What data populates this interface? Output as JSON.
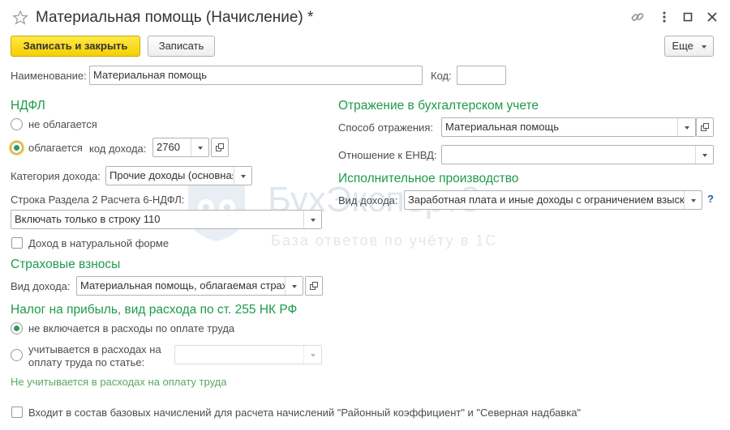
{
  "window": {
    "title": "Материальная помощь (Начисление) *",
    "star_icon": "star-outline-icon",
    "link_icon": "link-icon",
    "menu_icon": "more-vertical-icon",
    "maximize_icon": "maximize-icon",
    "close_icon": "close-icon"
  },
  "toolbar": {
    "save_close_label": "Записать и закрыть",
    "save_label": "Записать",
    "more_label": "Еще"
  },
  "name": {
    "label": "Наименование:",
    "value": "Материальная помощь"
  },
  "code": {
    "label": "Код:",
    "value": ""
  },
  "ndfl": {
    "heading": "НДФЛ",
    "not_taxed_label": "не облагается",
    "taxed_label": "облагается",
    "selected": "taxed",
    "income_code_label": "код дохода:",
    "income_code_value": "2760",
    "category_label": "Категория дохода:",
    "category_value": "Прочие доходы (основная",
    "row_6ndfl_label": "Строка Раздела 2 Расчета 6-НДФЛ:",
    "row_6ndfl_value": "Включать только в строку 110",
    "in_kind_label": "Доход в натуральной форме",
    "in_kind_checked": false
  },
  "insurance": {
    "heading": "Страховые взносы",
    "income_type_label": "Вид дохода:",
    "income_type_value": "Материальная помощь, облагаемая страх"
  },
  "profit_tax": {
    "heading": "Налог на прибыль, вид расхода по ст. 255 НК РФ",
    "option1_label": "не включается в расходы по оплате труда",
    "option2_line1": "учитывается в расходах на",
    "option2_line2": "оплату труда по статье:",
    "selected": "option1",
    "article_value": "",
    "hint": "Не учитывается в расходах на оплату труда"
  },
  "accounting": {
    "heading": "Отражение в бухгалтерском учете",
    "method_label": "Способ отражения:",
    "method_value": "Материальная помощь",
    "envd_label": "Отношение к ЕНВД:",
    "envd_value": ""
  },
  "enforcement": {
    "heading": "Исполнительное производство",
    "income_type_label": "Вид дохода:",
    "income_type_value": "Заработная плата и иные доходы с ограничением взыск",
    "help_label": "?"
  },
  "base_accruals": {
    "label": "Входит в состав базовых начислений для расчета начислений \"Районный коэффициент\" и \"Северная надбавка\"",
    "checked": false
  },
  "watermark": {
    "title": "БухЭксперт8",
    "subtitle": "База ответов по учёту в 1С"
  },
  "colors": {
    "accent_green": "#1e9a4b",
    "primary_button": "#f5cf00",
    "help_blue": "#1f5fa8"
  }
}
